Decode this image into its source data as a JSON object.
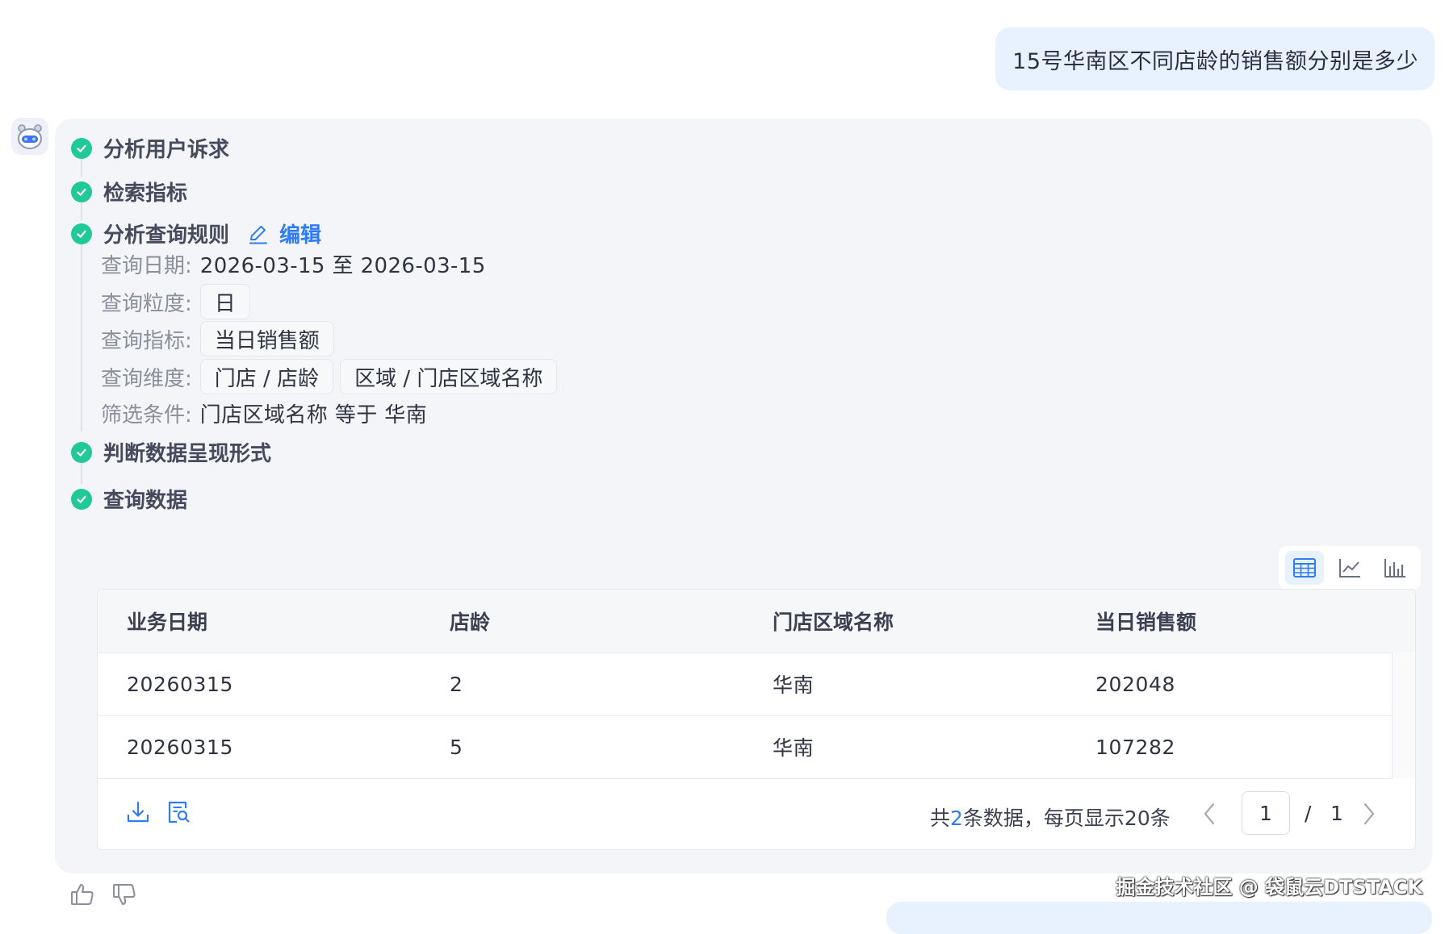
{
  "user_message": "15号华南区不同店龄的销售额分别是多少",
  "steps": {
    "analyze": "分析用户诉求",
    "retrieve": "检索指标",
    "rules": "分析查询规则",
    "edit": "编辑",
    "judge": "判断数据呈现形式",
    "query": "查询数据"
  },
  "rules": {
    "date_label": "查询日期:",
    "date_value": "2026-03-15 至 2026-03-15",
    "granularity_label": "查询粒度:",
    "granularity_value": "日",
    "metric_label": "查询指标:",
    "metric_value": "当日销售额",
    "dimension_label": "查询维度:",
    "dimensions": [
      "门店 / 店龄",
      "区域 / 门店区域名称"
    ],
    "filter_label": "筛选条件:",
    "filter_value": "门店区域名称 等于 华南"
  },
  "view_toggle": {
    "active": "table",
    "icons": [
      "table-icon",
      "line-chart-icon",
      "bar-chart-icon"
    ]
  },
  "table": {
    "columns": [
      "业务日期",
      "店龄",
      "门店区域名称",
      "当日销售额"
    ],
    "rows": [
      [
        "20260315",
        "2",
        "华南",
        "202048"
      ],
      [
        "20260315",
        "5",
        "华南",
        "107282"
      ]
    ]
  },
  "pagination": {
    "summary_prefix": "共",
    "count": "2",
    "summary_suffix": "条数据，每页显示20条",
    "current_page": "1",
    "separator": "/",
    "total_pages": "1"
  },
  "watermark": "掘金技术社区 @ 袋鼠云DTSTACK",
  "colors": {
    "accent": "#2f7cf6",
    "success": "#20c997",
    "user_bubble": "#e8f1fe",
    "card_bg": "#f4f5f8"
  }
}
